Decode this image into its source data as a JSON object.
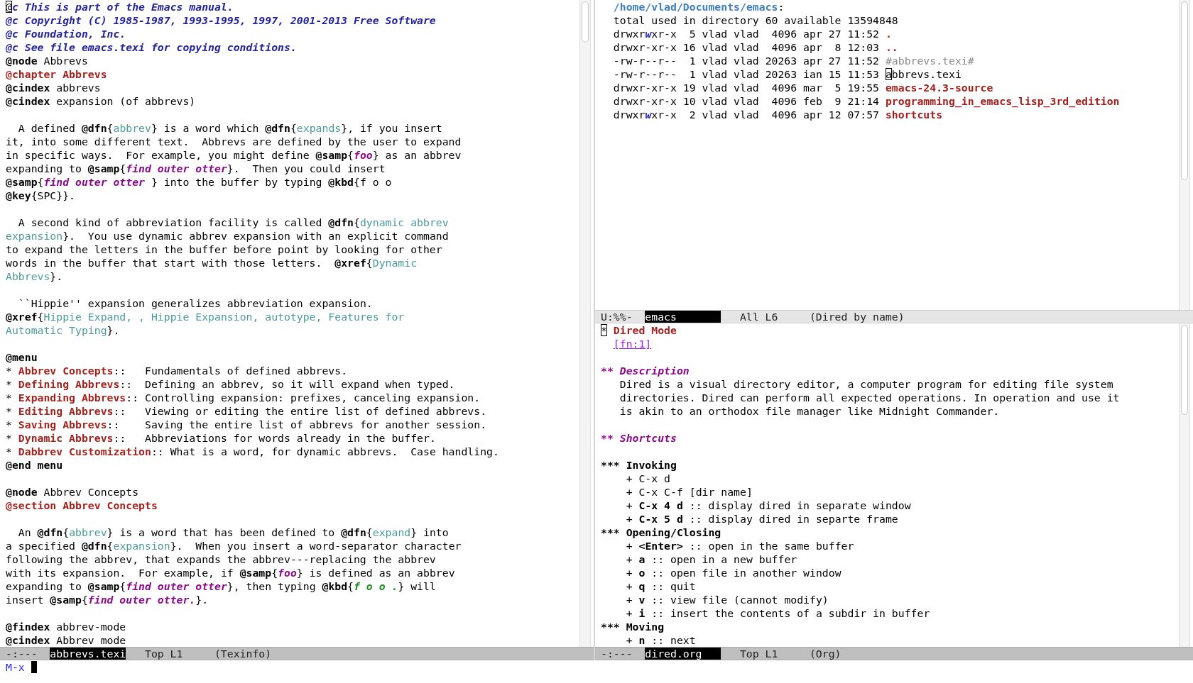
{
  "texinfo_window": {
    "lines": [
      {
        "kind": "text",
        "segments": [
          {
            "kind": "cursor",
            "text": "@"
          },
          {
            "kind": "comment",
            "text": "c This is part of the Emacs manual."
          }
        ]
      },
      {
        "kind": "text",
        "segments": [
          {
            "kind": "comment",
            "text": "@c Copyright (C) 1985-1987, 1993-1995, 1997, 2001-2013 Free Software"
          }
        ]
      },
      {
        "kind": "text",
        "segments": [
          {
            "kind": "comment",
            "text": "@c Foundation, Inc."
          }
        ]
      },
      {
        "kind": "text",
        "segments": [
          {
            "kind": "comment",
            "text": "@c See file emacs.texi for copying conditions."
          }
        ]
      },
      {
        "kind": "text",
        "segments": [
          {
            "kind": "keyword",
            "text": "@node"
          },
          {
            "kind": "plain",
            "text": " Abbrevs"
          }
        ]
      },
      {
        "kind": "text",
        "segments": [
          {
            "kind": "heading",
            "text": "@chapter Abbrevs"
          }
        ]
      },
      {
        "kind": "text",
        "segments": [
          {
            "kind": "keyword",
            "text": "@cindex"
          },
          {
            "kind": "plain",
            "text": " abbrevs"
          }
        ]
      },
      {
        "kind": "text",
        "segments": [
          {
            "kind": "keyword",
            "text": "@cindex"
          },
          {
            "kind": "plain",
            "text": " expansion (of abbrevs)"
          }
        ]
      },
      {
        "kind": "blank"
      },
      {
        "kind": "text",
        "segments": [
          {
            "kind": "plain",
            "text": "  A defined "
          },
          {
            "kind": "keyword",
            "text": "@dfn"
          },
          {
            "kind": "plain",
            "text": "{"
          },
          {
            "kind": "ref",
            "text": "abbrev"
          },
          {
            "kind": "plain",
            "text": "} is a word which "
          },
          {
            "kind": "keyword",
            "text": "@dfn"
          },
          {
            "kind": "plain",
            "text": "{"
          },
          {
            "kind": "ref",
            "text": "expands"
          },
          {
            "kind": "plain",
            "text": "}, if you insert"
          }
        ]
      },
      {
        "kind": "text",
        "segments": [
          {
            "kind": "plain",
            "text": "it, into some different text.  Abbrevs are defined by the user to expand"
          }
        ]
      },
      {
        "kind": "text",
        "segments": [
          {
            "kind": "plain",
            "text": "in specific ways.  For example, you might define "
          },
          {
            "kind": "keyword",
            "text": "@samp"
          },
          {
            "kind": "plain",
            "text": "{"
          },
          {
            "kind": "samp",
            "text": "foo"
          },
          {
            "kind": "plain",
            "text": "} as an abbrev"
          }
        ]
      },
      {
        "kind": "text",
        "segments": [
          {
            "kind": "plain",
            "text": "expanding to "
          },
          {
            "kind": "keyword",
            "text": "@samp"
          },
          {
            "kind": "plain",
            "text": "{"
          },
          {
            "kind": "samp",
            "text": "find outer otter"
          },
          {
            "kind": "plain",
            "text": "}.  Then you could insert"
          }
        ]
      },
      {
        "kind": "text",
        "segments": [
          {
            "kind": "keyword",
            "text": "@samp"
          },
          {
            "kind": "plain",
            "text": "{"
          },
          {
            "kind": "samp",
            "text": "find outer otter "
          },
          {
            "kind": "plain",
            "text": "} into the buffer by typing "
          },
          {
            "kind": "keyword",
            "text": "@kbd"
          },
          {
            "kind": "plain",
            "text": "{f o o"
          }
        ]
      },
      {
        "kind": "text",
        "segments": [
          {
            "kind": "keyword",
            "text": "@key"
          },
          {
            "kind": "plain",
            "text": "{SPC}}."
          }
        ]
      },
      {
        "kind": "blank"
      },
      {
        "kind": "text",
        "segments": [
          {
            "kind": "plain",
            "text": "  A second kind of abbreviation facility is called "
          },
          {
            "kind": "keyword",
            "text": "@dfn"
          },
          {
            "kind": "plain",
            "text": "{"
          },
          {
            "kind": "ref",
            "text": "dynamic abbrev"
          }
        ]
      },
      {
        "kind": "text",
        "segments": [
          {
            "kind": "ref",
            "text": "expansion"
          },
          {
            "kind": "plain",
            "text": "}.  You use dynamic abbrev expansion with an explicit command"
          }
        ]
      },
      {
        "kind": "text",
        "segments": [
          {
            "kind": "plain",
            "text": "to expand the letters in the buffer before point by looking for other"
          }
        ]
      },
      {
        "kind": "text",
        "segments": [
          {
            "kind": "plain",
            "text": "words in the buffer that start with those letters.  "
          },
          {
            "kind": "keyword",
            "text": "@xref"
          },
          {
            "kind": "plain",
            "text": "{"
          },
          {
            "kind": "ref",
            "text": "Dynamic"
          }
        ]
      },
      {
        "kind": "text",
        "segments": [
          {
            "kind": "ref",
            "text": "Abbrevs"
          },
          {
            "kind": "plain",
            "text": "}."
          }
        ]
      },
      {
        "kind": "blank"
      },
      {
        "kind": "text",
        "segments": [
          {
            "kind": "plain",
            "text": "  ``Hippie'' expansion generalizes abbreviation expansion."
          }
        ]
      },
      {
        "kind": "text",
        "segments": [
          {
            "kind": "keyword",
            "text": "@xref"
          },
          {
            "kind": "plain",
            "text": "{"
          },
          {
            "kind": "ref",
            "text": "Hippie Expand, , Hippie Expansion, autotype, Features for"
          }
        ]
      },
      {
        "kind": "text",
        "segments": [
          {
            "kind": "ref",
            "text": "Automatic Typing"
          },
          {
            "kind": "plain",
            "text": "}."
          }
        ]
      },
      {
        "kind": "blank"
      },
      {
        "kind": "text",
        "segments": [
          {
            "kind": "keyword",
            "text": "@menu"
          }
        ]
      },
      {
        "kind": "text",
        "segments": [
          {
            "kind": "plain",
            "text": "* "
          },
          {
            "kind": "heading",
            "text": "Abbrev Concepts"
          },
          {
            "kind": "plain",
            "text": "::   Fundamentals of defined abbrevs."
          }
        ]
      },
      {
        "kind": "text",
        "segments": [
          {
            "kind": "plain",
            "text": "* "
          },
          {
            "kind": "heading",
            "text": "Defining Abbrevs"
          },
          {
            "kind": "plain",
            "text": "::  Defining an abbrev, so it will expand when typed."
          }
        ]
      },
      {
        "kind": "text",
        "segments": [
          {
            "kind": "plain",
            "text": "* "
          },
          {
            "kind": "heading",
            "text": "Expanding Abbrevs"
          },
          {
            "kind": "plain",
            "text": ":: Controlling expansion: prefixes, canceling expansion."
          }
        ]
      },
      {
        "kind": "text",
        "segments": [
          {
            "kind": "plain",
            "text": "* "
          },
          {
            "kind": "heading",
            "text": "Editing Abbrevs"
          },
          {
            "kind": "plain",
            "text": "::   Viewing or editing the entire list of defined abbrevs."
          }
        ]
      },
      {
        "kind": "text",
        "segments": [
          {
            "kind": "plain",
            "text": "* "
          },
          {
            "kind": "heading",
            "text": "Saving Abbrevs"
          },
          {
            "kind": "plain",
            "text": "::    Saving the entire list of abbrevs for another session."
          }
        ]
      },
      {
        "kind": "text",
        "segments": [
          {
            "kind": "plain",
            "text": "* "
          },
          {
            "kind": "heading",
            "text": "Dynamic Abbrevs"
          },
          {
            "kind": "plain",
            "text": "::   Abbreviations for words already in the buffer."
          }
        ]
      },
      {
        "kind": "text",
        "segments": [
          {
            "kind": "plain",
            "text": "* "
          },
          {
            "kind": "heading",
            "text": "Dabbrev Customization"
          },
          {
            "kind": "plain",
            "text": ":: What is a word, for dynamic abbrevs.  Case handling."
          }
        ]
      },
      {
        "kind": "text",
        "segments": [
          {
            "kind": "keyword",
            "text": "@end menu"
          }
        ]
      },
      {
        "kind": "blank"
      },
      {
        "kind": "text",
        "segments": [
          {
            "kind": "keyword",
            "text": "@node"
          },
          {
            "kind": "plain",
            "text": " Abbrev Concepts"
          }
        ]
      },
      {
        "kind": "text",
        "segments": [
          {
            "kind": "heading",
            "text": "@section Abbrev Concepts"
          }
        ]
      },
      {
        "kind": "blank"
      },
      {
        "kind": "text",
        "segments": [
          {
            "kind": "plain",
            "text": "  An "
          },
          {
            "kind": "keyword",
            "text": "@dfn"
          },
          {
            "kind": "plain",
            "text": "{"
          },
          {
            "kind": "ref",
            "text": "abbrev"
          },
          {
            "kind": "plain",
            "text": "} is a word that has been defined to "
          },
          {
            "kind": "keyword",
            "text": "@dfn"
          },
          {
            "kind": "plain",
            "text": "{"
          },
          {
            "kind": "ref",
            "text": "expand"
          },
          {
            "kind": "plain",
            "text": "} into"
          }
        ]
      },
      {
        "kind": "text",
        "segments": [
          {
            "kind": "plain",
            "text": "a specified "
          },
          {
            "kind": "keyword",
            "text": "@dfn"
          },
          {
            "kind": "plain",
            "text": "{"
          },
          {
            "kind": "ref",
            "text": "expansion"
          },
          {
            "kind": "plain",
            "text": "}.  When you insert a word-separator character"
          }
        ]
      },
      {
        "kind": "text",
        "segments": [
          {
            "kind": "plain",
            "text": "following the abbrev, that expands the abbrev---replacing the abbrev"
          }
        ]
      },
      {
        "kind": "text",
        "segments": [
          {
            "kind": "plain",
            "text": "with its expansion.  For example, if "
          },
          {
            "kind": "keyword",
            "text": "@samp"
          },
          {
            "kind": "plain",
            "text": "{"
          },
          {
            "kind": "samp",
            "text": "foo"
          },
          {
            "kind": "plain",
            "text": "} is defined as an abbrev"
          }
        ]
      },
      {
        "kind": "text",
        "segments": [
          {
            "kind": "plain",
            "text": "expanding to "
          },
          {
            "kind": "keyword",
            "text": "@samp"
          },
          {
            "kind": "plain",
            "text": "{"
          },
          {
            "kind": "samp",
            "text": "find outer otter"
          },
          {
            "kind": "plain",
            "text": "}, then typing "
          },
          {
            "kind": "keyword",
            "text": "@kbd"
          },
          {
            "kind": "plain",
            "text": "{"
          },
          {
            "kind": "kbd",
            "text": "f o o ."
          },
          {
            "kind": "plain",
            "text": "} will"
          }
        ]
      },
      {
        "kind": "text",
        "segments": [
          {
            "kind": "plain",
            "text": "insert "
          },
          {
            "kind": "keyword",
            "text": "@samp"
          },
          {
            "kind": "plain",
            "text": "{"
          },
          {
            "kind": "samp",
            "text": "find outer otter."
          },
          {
            "kind": "plain",
            "text": "}."
          }
        ]
      },
      {
        "kind": "blank"
      },
      {
        "kind": "text",
        "segments": [
          {
            "kind": "keyword",
            "text": "@findex"
          },
          {
            "kind": "plain",
            "text": " abbrev-mode"
          }
        ]
      },
      {
        "kind": "text",
        "segments": [
          {
            "kind": "keyword",
            "text": "@cindex"
          },
          {
            "kind": "plain",
            "text": " Abbrev mode"
          }
        ]
      }
    ],
    "mode_line": {
      "status": "-:---",
      "buffer": "abbrevs.texi",
      "position": "Top L1",
      "mode": "(Texinfo)",
      "active": true
    }
  },
  "dired_window": {
    "lines": [
      {
        "kind": "text",
        "segments": [
          {
            "kind": "path",
            "text": "  /home/vlad/Documents/emacs"
          },
          {
            "kind": "plain",
            "text": ":"
          }
        ]
      },
      {
        "kind": "text",
        "segments": [
          {
            "kind": "plain",
            "text": "  total used in directory 60 available 13594848"
          }
        ]
      },
      {
        "kind": "text",
        "segments": [
          {
            "kind": "plain",
            "text": "  drwxr"
          },
          {
            "kind": "perm",
            "text": "w"
          },
          {
            "kind": "plain",
            "text": "xr-x  5 vlad vlad  4096 apr 27 11:52 "
          },
          {
            "kind": "dir",
            "text": "."
          }
        ]
      },
      {
        "kind": "text",
        "segments": [
          {
            "kind": "plain",
            "text": "  drwxr-xr-x 16 vlad vlad  4096 apr  8 12:03 "
          },
          {
            "kind": "dir",
            "text": ".."
          }
        ]
      },
      {
        "kind": "text",
        "segments": [
          {
            "kind": "plain",
            "text": "  -rw-r--r--  1 vlad vlad 20263 apr 27 11:52 "
          },
          {
            "kind": "dim",
            "text": "#abbrevs.texi#"
          }
        ]
      },
      {
        "kind": "text",
        "segments": [
          {
            "kind": "plain",
            "text": "  -rw-r--r--  1 vlad vlad 20263 ian 15 11:53 "
          },
          {
            "kind": "cursor",
            "text": "a"
          },
          {
            "kind": "plain",
            "text": "bbrevs.texi"
          }
        ]
      },
      {
        "kind": "text",
        "segments": [
          {
            "kind": "plain",
            "text": "  drwxr-xr-x 19 vlad vlad  4096 mar  5 19:55 "
          },
          {
            "kind": "dir",
            "text": "emacs-24.3-source"
          }
        ]
      },
      {
        "kind": "text",
        "segments": [
          {
            "kind": "plain",
            "text": "  drwxr-xr-x 10 vlad vlad  4096 feb  9 21:14 "
          },
          {
            "kind": "dir",
            "text": "programming_in_emacs_lisp_3rd_edition"
          }
        ]
      },
      {
        "kind": "text",
        "segments": [
          {
            "kind": "plain",
            "text": "  drwxr"
          },
          {
            "kind": "perm",
            "text": "w"
          },
          {
            "kind": "plain",
            "text": "xr-x  2 vlad vlad  4096 apr 12 07:57 "
          },
          {
            "kind": "dir",
            "text": "shortcuts"
          }
        ]
      }
    ],
    "mode_line": {
      "status": "U:%%-",
      "buffer": "emacs",
      "position": "All L6",
      "mode": "(Dired by name)",
      "active": false
    }
  },
  "org_window": {
    "lines": [
      {
        "kind": "text",
        "segments": [
          {
            "kind": "cursor",
            "text": "*"
          },
          {
            "kind": "title",
            "text": " Dired Mode"
          }
        ]
      },
      {
        "kind": "text",
        "segments": [
          {
            "kind": "footnote",
            "text": "  [fn:1]"
          }
        ]
      },
      {
        "kind": "blank"
      },
      {
        "kind": "text",
        "segments": [
          {
            "kind": "h2",
            "text": "** Description"
          }
        ]
      },
      {
        "kind": "text",
        "segments": [
          {
            "kind": "plain",
            "text": "   Dired is a visual directory editor, a computer program for editing file system"
          }
        ]
      },
      {
        "kind": "text",
        "segments": [
          {
            "kind": "plain",
            "text": "   directories. Dired can perform all expected operations. In operation and use it"
          }
        ]
      },
      {
        "kind": "text",
        "segments": [
          {
            "kind": "plain",
            "text": "   is akin to an orthodox file manager like Midnight Commander."
          }
        ]
      },
      {
        "kind": "blank"
      },
      {
        "kind": "text",
        "segments": [
          {
            "kind": "h2",
            "text": "** Shortcuts"
          }
        ]
      },
      {
        "kind": "blank"
      },
      {
        "kind": "text",
        "segments": [
          {
            "kind": "bold",
            "text": "*** Invoking"
          }
        ]
      },
      {
        "kind": "text",
        "segments": [
          {
            "kind": "plain",
            "text": "    + C-x d"
          }
        ]
      },
      {
        "kind": "text",
        "segments": [
          {
            "kind": "plain",
            "text": "    + C-x C-f [dir name]"
          }
        ]
      },
      {
        "kind": "text",
        "segments": [
          {
            "kind": "plain",
            "text": "    + "
          },
          {
            "kind": "bold",
            "text": "C-x 4 d"
          },
          {
            "kind": "plain",
            "text": " :: display dired in separate window"
          }
        ]
      },
      {
        "kind": "text",
        "segments": [
          {
            "kind": "plain",
            "text": "    + "
          },
          {
            "kind": "bold",
            "text": "C-x 5 d"
          },
          {
            "kind": "plain",
            "text": " :: display dired in separte frame"
          }
        ]
      },
      {
        "kind": "text",
        "segments": [
          {
            "kind": "bold",
            "text": "*** Opening/Closing"
          }
        ]
      },
      {
        "kind": "text",
        "segments": [
          {
            "kind": "plain",
            "text": "    + "
          },
          {
            "kind": "bold",
            "text": "<Enter>"
          },
          {
            "kind": "plain",
            "text": " :: open in the same buffer"
          }
        ]
      },
      {
        "kind": "text",
        "segments": [
          {
            "kind": "plain",
            "text": "    + "
          },
          {
            "kind": "bold",
            "text": "a"
          },
          {
            "kind": "plain",
            "text": " :: open in a new buffer"
          }
        ]
      },
      {
        "kind": "text",
        "segments": [
          {
            "kind": "plain",
            "text": "    + "
          },
          {
            "kind": "bold",
            "text": "o"
          },
          {
            "kind": "plain",
            "text": " :: open file in another window"
          }
        ]
      },
      {
        "kind": "text",
        "segments": [
          {
            "kind": "plain",
            "text": "    + "
          },
          {
            "kind": "bold",
            "text": "q"
          },
          {
            "kind": "plain",
            "text": " :: quit"
          }
        ]
      },
      {
        "kind": "text",
        "segments": [
          {
            "kind": "plain",
            "text": "    + "
          },
          {
            "kind": "bold",
            "text": "v"
          },
          {
            "kind": "plain",
            "text": " :: view file (cannot modify)"
          }
        ]
      },
      {
        "kind": "text",
        "segments": [
          {
            "kind": "plain",
            "text": "    + "
          },
          {
            "kind": "bold",
            "text": "i"
          },
          {
            "kind": "plain",
            "text": " :: insert the contents of a subdir in buffer"
          }
        ]
      },
      {
        "kind": "text",
        "segments": [
          {
            "kind": "bold",
            "text": "*** Moving"
          }
        ]
      },
      {
        "kind": "text",
        "segments": [
          {
            "kind": "plain",
            "text": "    + "
          },
          {
            "kind": "bold",
            "text": "n"
          },
          {
            "kind": "plain",
            "text": " :: next"
          }
        ]
      }
    ],
    "mode_line": {
      "status": "-:---",
      "buffer": "dired.org",
      "position": "Top L1",
      "mode": "(Org)",
      "active": true
    }
  },
  "minibuffer": {
    "prompt": "M-x"
  }
}
